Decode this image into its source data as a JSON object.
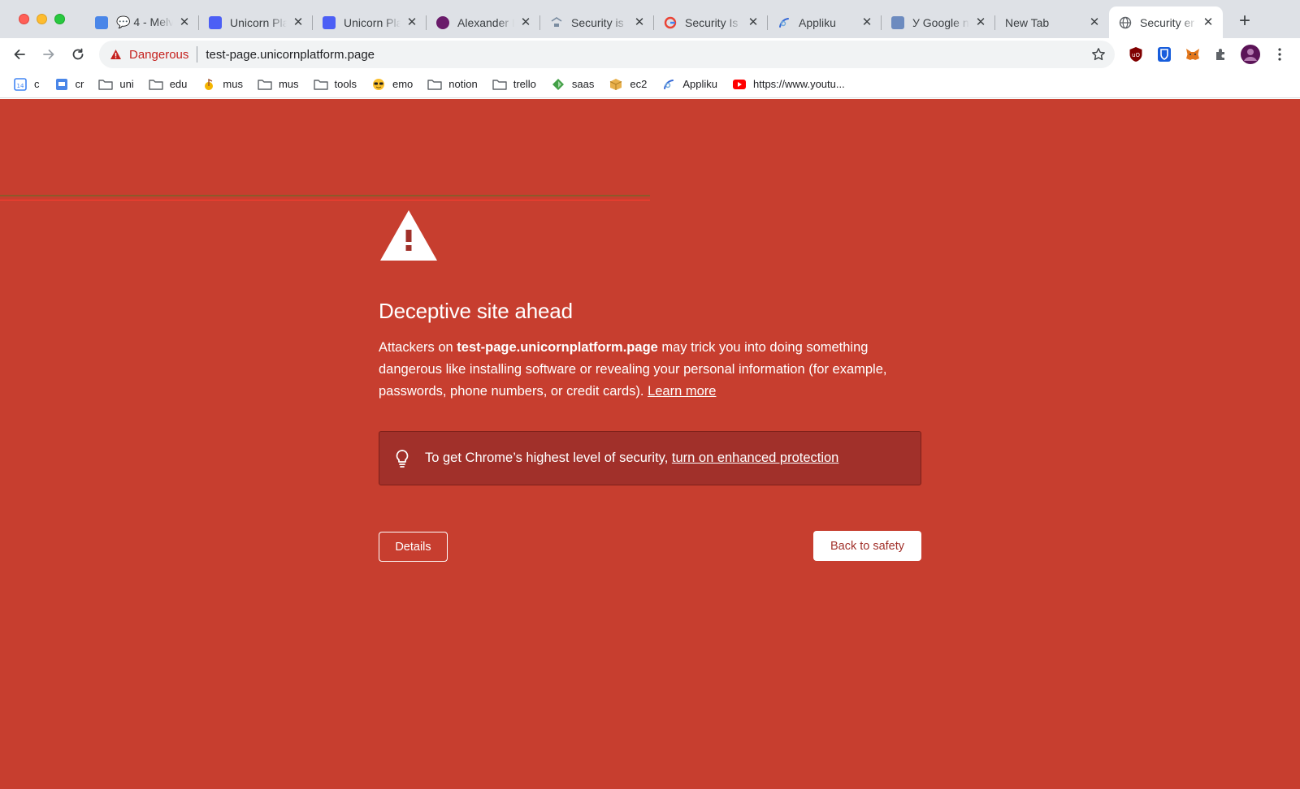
{
  "window": {
    "colors": {
      "page_bg": "#c73e2f",
      "box_bg": "#a1302a",
      "danger": "#c5221f"
    }
  },
  "tabs": [
    {
      "title": "💬 4 - Melv",
      "icon": "chat-app-icon",
      "color": "#4a86e8"
    },
    {
      "title": "Unicorn Pla",
      "icon": "unicorn-platform-icon",
      "color": "#4c5ff5"
    },
    {
      "title": "Unicorn Pla",
      "icon": "unicorn-platform-icon",
      "color": "#4c5ff5"
    },
    {
      "title": "Alexander I",
      "icon": "avatar-icon",
      "color": "#6a1b6a"
    },
    {
      "title": "Security is",
      "icon": "security-site-icon",
      "color": "#7a8ca0"
    },
    {
      "title": "Security Is",
      "icon": "google-icon",
      "color": "#4285f4"
    },
    {
      "title": "Appliku",
      "icon": "appliku-icon",
      "color": "#3367d6"
    },
    {
      "title": "У Google n",
      "icon": "puzzle-site-icon",
      "color": "#6d8bbf"
    },
    {
      "title": "New Tab",
      "icon": "",
      "color": ""
    },
    {
      "title": "Security er",
      "icon": "globe-icon",
      "color": "#5f6368",
      "active": true
    }
  ],
  "omnibox": {
    "danger_label": "Dangerous",
    "url": "test-page.unicornplatform.page"
  },
  "bookmarks": [
    {
      "label": "c",
      "icon": "calendar-icon"
    },
    {
      "label": "cr",
      "icon": "chat-app-icon"
    },
    {
      "label": "uni",
      "icon": "folder-icon"
    },
    {
      "label": "edu",
      "icon": "folder-icon"
    },
    {
      "label": "mus",
      "icon": "music-icon"
    },
    {
      "label": "mus",
      "icon": "folder-icon"
    },
    {
      "label": "tools",
      "icon": "folder-icon"
    },
    {
      "label": "emo",
      "icon": "sunglasses-emoji-icon"
    },
    {
      "label": "notion",
      "icon": "folder-icon"
    },
    {
      "label": "trello",
      "icon": "folder-icon"
    },
    {
      "label": "saas",
      "icon": "saas-diamond-icon"
    },
    {
      "label": "ec2",
      "icon": "box-icon"
    },
    {
      "label": "Appliku",
      "icon": "appliku-icon"
    },
    {
      "label": "https://www.youtu...",
      "icon": "youtube-icon"
    }
  ],
  "interstitial": {
    "heading": "Deceptive site ahead",
    "body_prefix": "Attackers on ",
    "body_domain": "test-page.unicornplatform.page",
    "body_rest": " may trick you into doing something dangerous like installing software or revealing your personal information (for example, passwords, phone numbers, or credit cards). ",
    "learn_more": "Learn more",
    "enhanced_prefix": "To get Chrome’s highest level of security, ",
    "enhanced_link": "turn on enhanced protection",
    "details_button": "Details",
    "back_button": "Back to safety"
  }
}
